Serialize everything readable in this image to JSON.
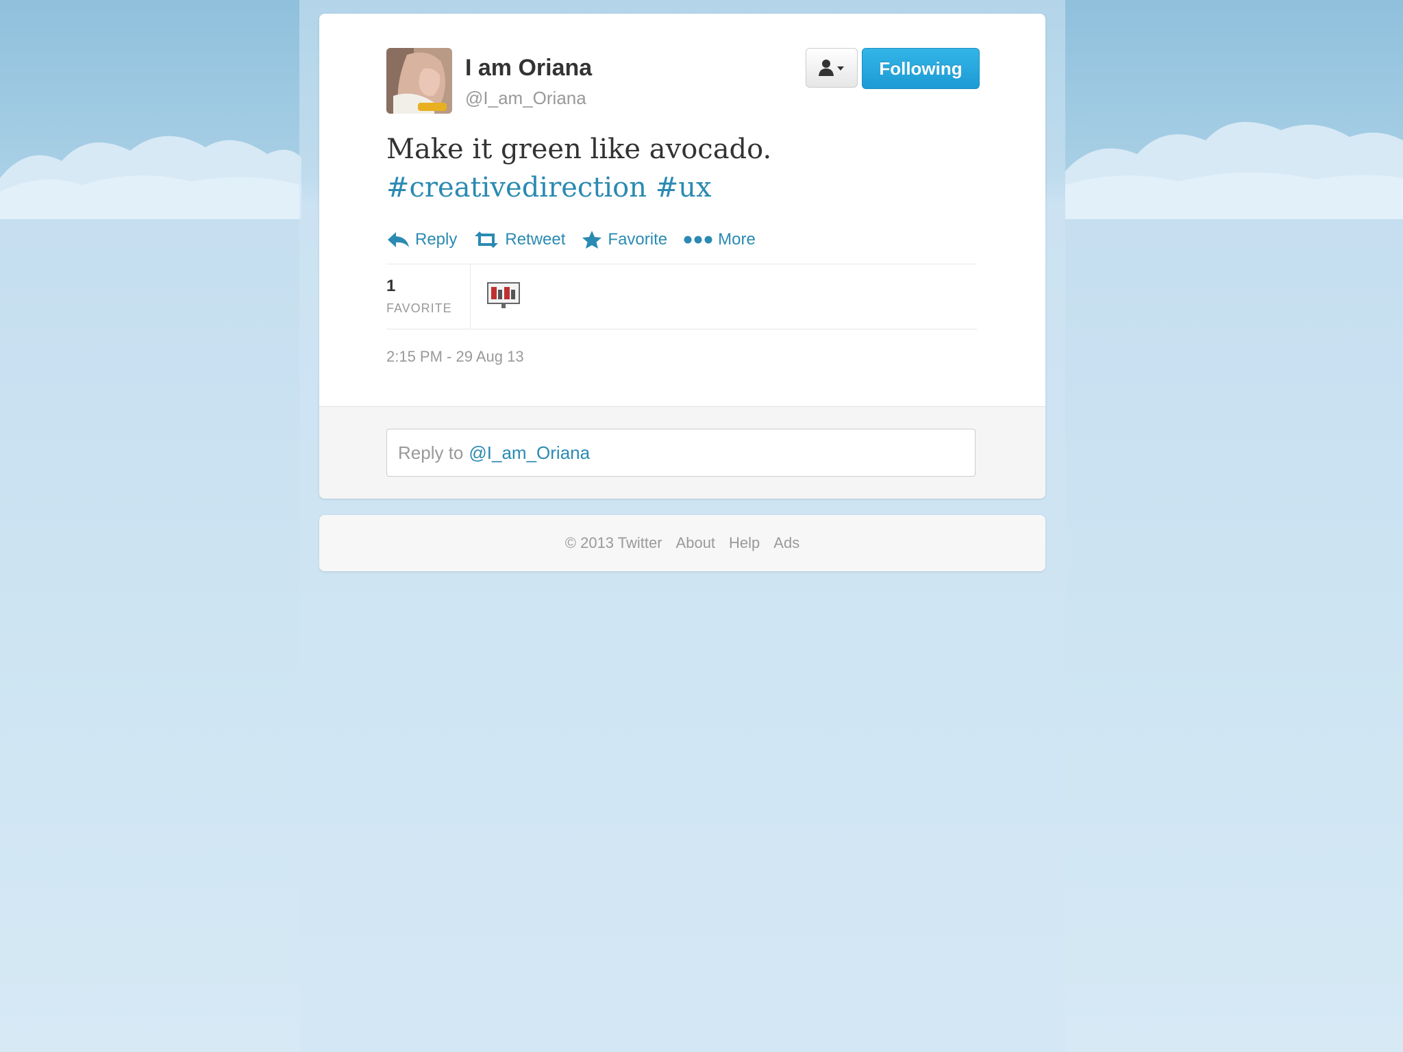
{
  "tweet": {
    "author_name": "I am Oriana",
    "author_handle": "@I_am_Oriana",
    "text": "Make it green like avocado.",
    "hashtags": [
      "#creativedirection",
      "#ux"
    ],
    "timestamp": "2:15 PM - 29 Aug 13"
  },
  "header": {
    "following_label": "Following"
  },
  "actions": {
    "reply": "Reply",
    "retweet": "Retweet",
    "favorite": "Favorite",
    "more": "More"
  },
  "stats": {
    "favorite_count": "1",
    "favorite_label": "FAVORITE"
  },
  "reply_box": {
    "prefix": "Reply to",
    "handle": "@I_am_Oriana"
  },
  "footer": {
    "copyright": "© 2013 Twitter",
    "links": [
      "About",
      "Help",
      "Ads"
    ]
  },
  "colors": {
    "link": "#2a8ab2",
    "follow_button": "#1c9bd4",
    "sky": "#c9e1f0"
  }
}
